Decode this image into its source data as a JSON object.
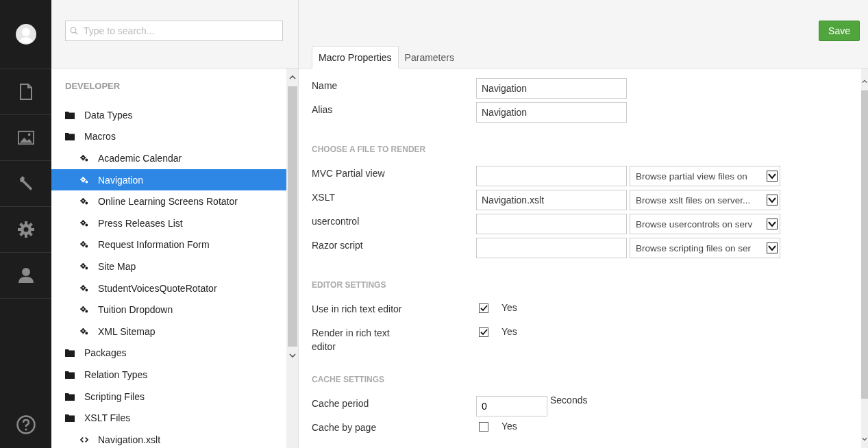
{
  "search": {
    "placeholder": "Type to search..."
  },
  "tree": {
    "section": "DEVELOPER",
    "items": [
      {
        "label": "Data Types",
        "kind": "folder",
        "selected": false
      },
      {
        "label": "Macros",
        "kind": "folder",
        "selected": false,
        "children": [
          {
            "label": "Academic Calendar",
            "kind": "macro",
            "selected": false
          },
          {
            "label": "Navigation",
            "kind": "macro",
            "selected": true
          },
          {
            "label": "Online Learning Screens Rotator",
            "kind": "macro",
            "selected": false
          },
          {
            "label": "Press Releases List",
            "kind": "macro",
            "selected": false
          },
          {
            "label": "Request Information Form",
            "kind": "macro",
            "selected": false
          },
          {
            "label": "Site Map",
            "kind": "macro",
            "selected": false
          },
          {
            "label": "StudentVoicesQuoteRotator",
            "kind": "macro",
            "selected": false
          },
          {
            "label": "Tuition Dropdown",
            "kind": "macro",
            "selected": false
          },
          {
            "label": "XML Sitemap",
            "kind": "macro",
            "selected": false
          }
        ]
      },
      {
        "label": "Packages",
        "kind": "folder",
        "selected": false
      },
      {
        "label": "Relation Types",
        "kind": "folder",
        "selected": false
      },
      {
        "label": "Scripting Files",
        "kind": "folder",
        "selected": false
      },
      {
        "label": "XSLT Files",
        "kind": "folder",
        "selected": false,
        "children": [
          {
            "label": "Navigation.xslt",
            "kind": "code",
            "selected": false
          }
        ]
      }
    ]
  },
  "save_button": "Save",
  "tabs": [
    {
      "label": "Macro Properties",
      "selected": true
    },
    {
      "label": "Parameters",
      "selected": false
    }
  ],
  "sections": [
    {
      "rows": [
        {
          "kind": "text",
          "label": "Name",
          "value": "Navigation"
        },
        {
          "kind": "text",
          "label": "Alias",
          "value": "Navigation"
        }
      ]
    },
    {
      "heading": "CHOOSE A FILE TO RENDER",
      "rows": [
        {
          "kind": "file",
          "label": "MVC Partial view",
          "select": "Browse partial view files on"
        },
        {
          "kind": "file",
          "label": "XSLT",
          "value": "Navigation.xslt",
          "select": "Browse xslt files on server..."
        },
        {
          "kind": "file",
          "label": "usercontrol",
          "select": "Browse usercontrols on serv"
        },
        {
          "kind": "file",
          "label": "Razor script",
          "select": "Browse scripting files on ser"
        }
      ]
    },
    {
      "heading": "EDITOR SETTINGS",
      "rows": [
        {
          "kind": "checkbox",
          "label": "Use in rich text editor",
          "checked": true,
          "text": "Yes"
        },
        {
          "kind": "checkbox",
          "label": "Render in rich text editor",
          "checked": true,
          "text": "Yes"
        }
      ]
    },
    {
      "heading": "CACHE SETTINGS",
      "rows": [
        {
          "kind": "number",
          "label": "Cache period",
          "value": "0",
          "unit": "Seconds"
        },
        {
          "kind": "checkbox",
          "label": "Cache by page",
          "checked": false,
          "text": "Yes"
        }
      ]
    }
  ]
}
